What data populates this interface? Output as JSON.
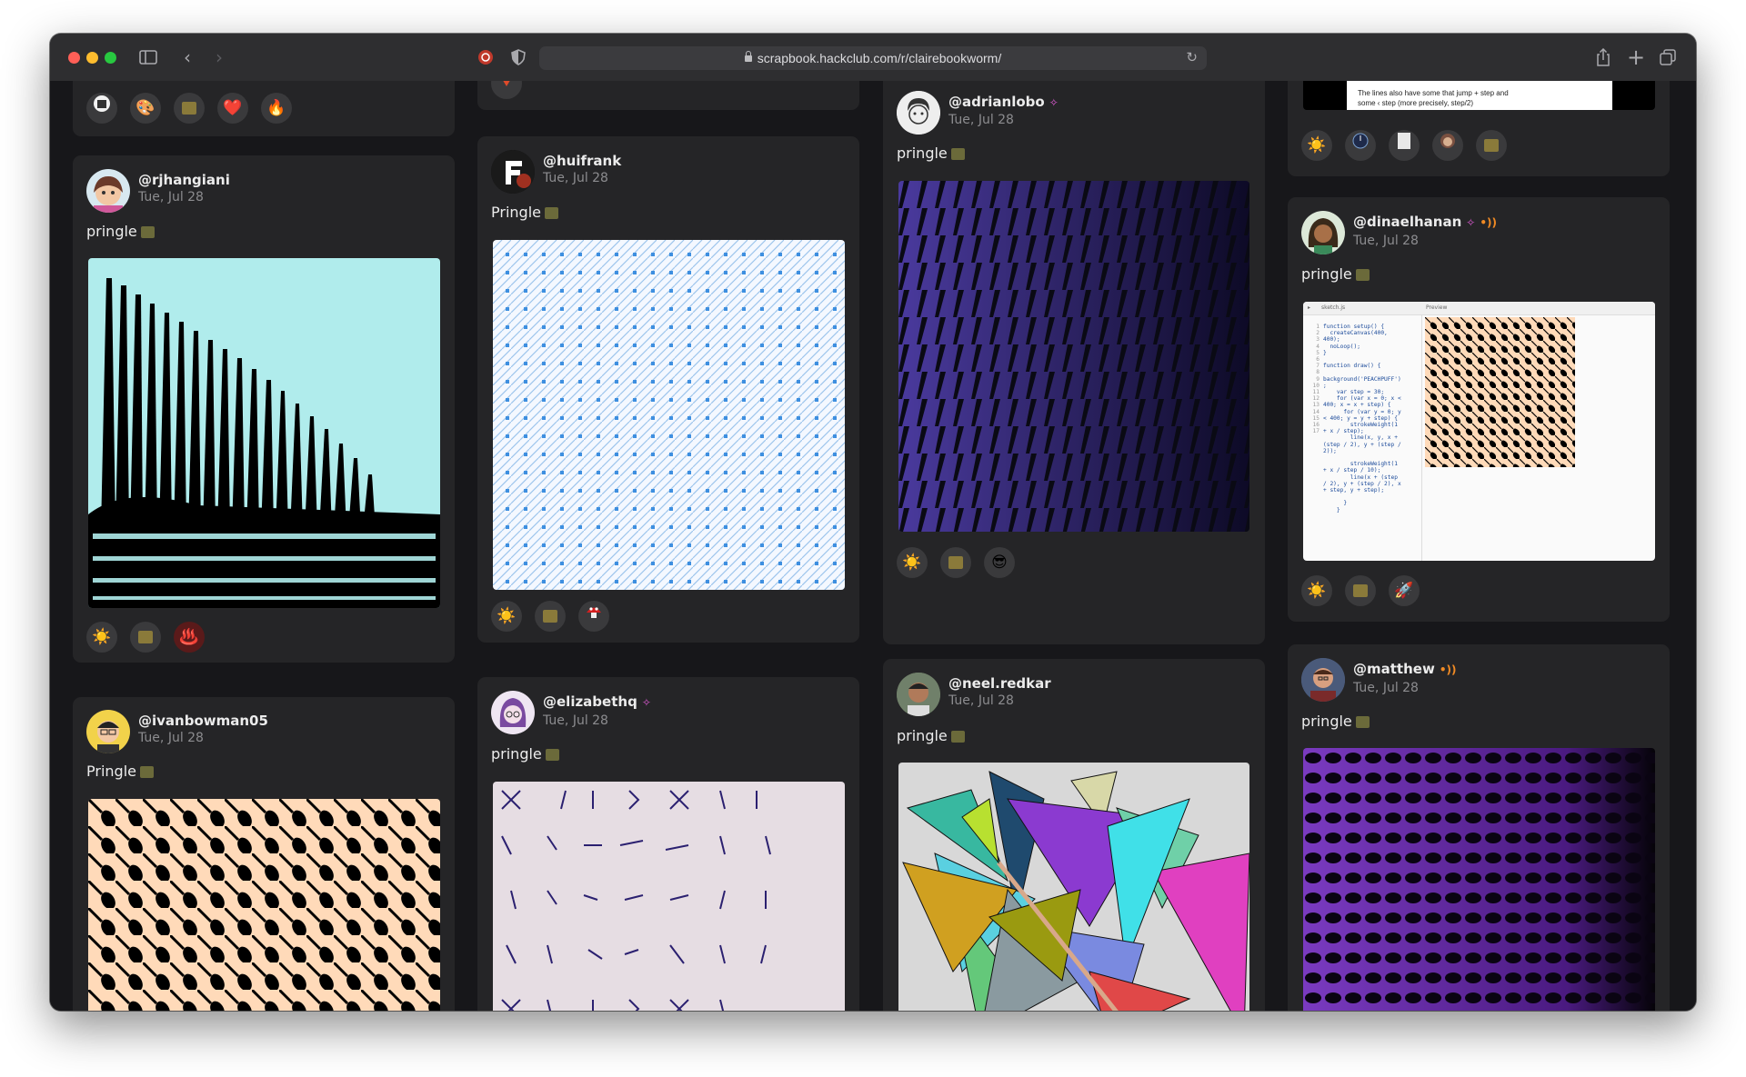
{
  "browser": {
    "url": "scrapbook.hackclub.com/r/clairebookworm/",
    "colors": {
      "close": "#ff5f57",
      "minimize": "#febc2e",
      "zoom": "#28c840"
    }
  },
  "posts": [
    {
      "username": "@rjhangiani",
      "date": "Tue, Jul 28",
      "caption": "pringle"
    },
    {
      "username": "@ivanbowman05",
      "date": "Tue, Jul 28",
      "caption": "Pringle"
    },
    {
      "username": "@huifrank",
      "date": "Tue, Jul 28",
      "caption": "Pringle"
    },
    {
      "username": "@elizabethq",
      "date": "Tue, Jul 28",
      "caption": "pringle"
    },
    {
      "username": "@adrianlobo",
      "date": "Tue, Jul 28",
      "caption": "pringle"
    },
    {
      "username": "@neel.redkar",
      "date": "Tue, Jul 28",
      "caption": "pringle"
    },
    {
      "username": "@dinaelhanan",
      "date": "Tue, Jul 28",
      "caption": "pringle"
    },
    {
      "username": "@matthew",
      "date": "Tue, Jul 28",
      "caption": "pringle"
    }
  ],
  "snippet": {
    "line1": "The lines also have some that jump + step and",
    "line2": "some ‹ step (more precisely, step/2)"
  },
  "editor": {
    "tab": "sketch.js",
    "preview": "Preview",
    "line_numbers": [
      "1",
      "2",
      "3",
      "4",
      "5",
      "6",
      "7",
      "8",
      "9",
      "10",
      "11",
      "12",
      "13",
      "14",
      "15",
      "16",
      "17"
    ],
    "code": [
      "function setup() {",
      "  createCanvas(400,",
      "400);",
      "  noLoop();",
      "}",
      "",
      "function draw() {",
      "",
      "background('PEACHPUFF')",
      ";",
      "    var step = 30;",
      "    for (var x = 0; x <",
      "400; x = x + step) {",
      "      for (var y = 0; y",
      "< 400; y = y + step) {",
      "        strokeWeight(1",
      "+ x / step);",
      "        line(x, y, x +",
      "(step / 2), y + (step /",
      "2));",
      "",
      "        strokeWeight(1",
      "+ x / step / 10);",
      "        line(x + (step",
      "/ 2), y + (step / 2), x",
      "+ step, y + step);",
      "",
      "      }",
      "    }"
    ]
  },
  "icons": [
    "sun-icon",
    "film-clip-icon",
    "heart-icon",
    "fire-icon",
    "palette-icon",
    "hot-springs-icon",
    "sunglasses-icon",
    "rocket-icon",
    "mushroom-icon",
    "sparkle-icon",
    "speaker-wave-icon"
  ],
  "reactions": {
    "heart": "❤️",
    "fire": "🔥",
    "palette": "🎨",
    "hotsprings": "♨️",
    "sunglasses": "😎",
    "rocket": "🚀",
    "sun": "☀️"
  }
}
